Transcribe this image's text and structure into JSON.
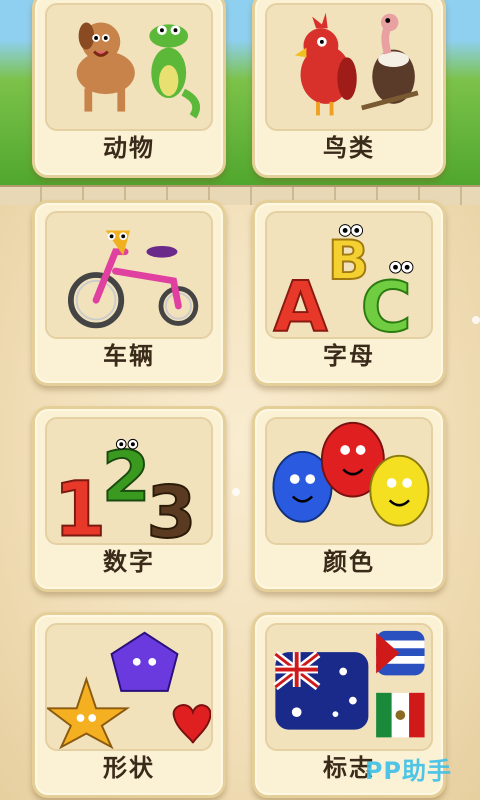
{
  "categories": [
    {
      "label": "动物",
      "icon": "dog-crocodile-icon"
    },
    {
      "label": "鸟类",
      "icon": "birds-icon"
    },
    {
      "label": "车辆",
      "icon": "tricycle-icon"
    },
    {
      "label": "字母",
      "icon": "abc-letters-icon"
    },
    {
      "label": "数字",
      "icon": "numbers-123-icon"
    },
    {
      "label": "颜色",
      "icon": "balloons-icon"
    },
    {
      "label": "形状",
      "icon": "shapes-icon"
    },
    {
      "label": "标志",
      "icon": "flags-icon"
    }
  ],
  "watermark": "PP助手",
  "colors": {
    "card_bg": "#fbf1d4",
    "card_border": "#e5cf98",
    "label_text": "#3a2a1a",
    "watermark": "#3cc0e8"
  }
}
